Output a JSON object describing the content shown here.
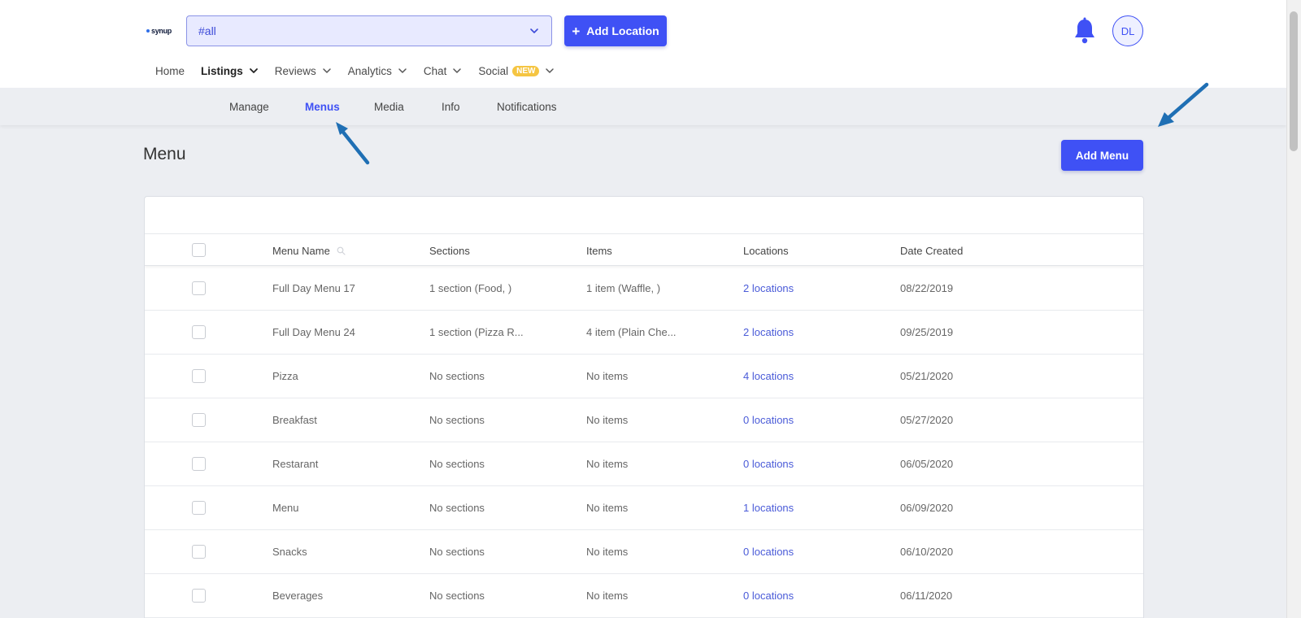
{
  "header": {
    "logo_text": "synup",
    "location_select": {
      "value": "#all"
    },
    "add_location_label": "Add Location",
    "avatar_initials": "DL"
  },
  "main_nav": [
    {
      "label": "Home",
      "has_chevron": false,
      "active": false
    },
    {
      "label": "Listings",
      "has_chevron": true,
      "active": true
    },
    {
      "label": "Reviews",
      "has_chevron": true,
      "active": false
    },
    {
      "label": "Analytics",
      "has_chevron": true,
      "active": false
    },
    {
      "label": "Chat",
      "has_chevron": true,
      "active": false
    },
    {
      "label": "Social",
      "has_chevron": true,
      "active": false,
      "badge": "NEW"
    }
  ],
  "sub_nav": [
    {
      "label": "Manage",
      "active": false
    },
    {
      "label": "Menus",
      "active": true
    },
    {
      "label": "Media",
      "active": false
    },
    {
      "label": "Info",
      "active": false
    },
    {
      "label": "Notifications",
      "active": false
    }
  ],
  "page": {
    "title": "Menu",
    "add_menu_label": "Add Menu"
  },
  "table": {
    "columns": [
      "Menu Name",
      "Sections",
      "Items",
      "Locations",
      "Date Created"
    ],
    "rows": [
      {
        "name": "Full Day Menu 17",
        "sections": "1 section (Food, )",
        "items": "1 item (Waffle, )",
        "locations": "2 locations",
        "date": "08/22/2019"
      },
      {
        "name": "Full Day Menu 24",
        "sections": "1 section (Pizza R...",
        "items": "4 item (Plain Che...",
        "locations": "2 locations",
        "date": "09/25/2019"
      },
      {
        "name": "Pizza",
        "sections": "No sections",
        "items": "No items",
        "locations": "4 locations",
        "date": "05/21/2020"
      },
      {
        "name": "Breakfast",
        "sections": "No sections",
        "items": "No items",
        "locations": "0 locations",
        "date": "05/27/2020"
      },
      {
        "name": "Restarant",
        "sections": "No sections",
        "items": "No items",
        "locations": "0 locations",
        "date": "06/05/2020"
      },
      {
        "name": "Menu",
        "sections": "No sections",
        "items": "No items",
        "locations": "1 locations",
        "date": "06/09/2020"
      },
      {
        "name": "Snacks",
        "sections": "No sections",
        "items": "No items",
        "locations": "0 locations",
        "date": "06/10/2020"
      },
      {
        "name": "Beverages",
        "sections": "No sections",
        "items": "No items",
        "locations": "0 locations",
        "date": "06/11/2020"
      }
    ]
  },
  "colors": {
    "accent": "#3f51f5",
    "link": "#4a5bd8",
    "annotation_arrow": "#1f6fb4",
    "badge": "#f5c542"
  }
}
